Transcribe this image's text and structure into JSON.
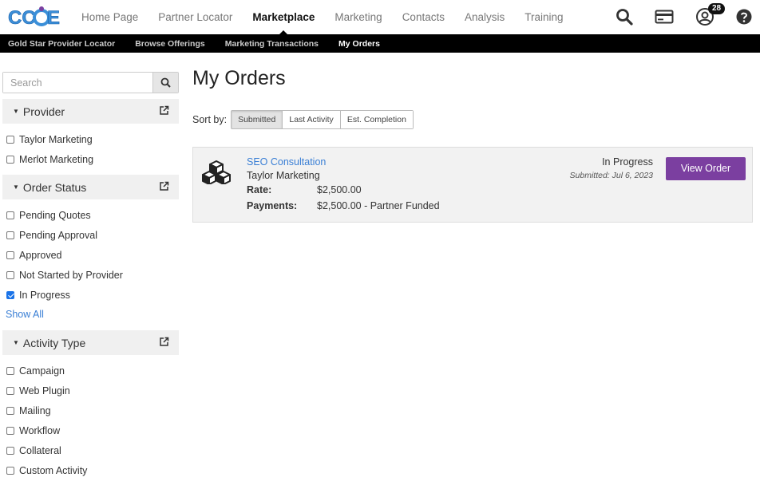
{
  "brand": {
    "logo_text": "CCOE",
    "accent_color": "#7b3fa0",
    "link_color": "#3a7fd5"
  },
  "topnav": {
    "items": [
      {
        "label": "Home Page",
        "active": false
      },
      {
        "label": "Partner Locator",
        "active": false
      },
      {
        "label": "Marketplace",
        "active": true
      },
      {
        "label": "Marketing",
        "active": false
      },
      {
        "label": "Contacts",
        "active": false
      },
      {
        "label": "Analysis",
        "active": false
      },
      {
        "label": "Training",
        "active": false
      }
    ],
    "icons": [
      "search-icon",
      "card-icon",
      "user-icon",
      "help-icon"
    ],
    "notification_count": "28"
  },
  "subnav": {
    "items": [
      {
        "label": "Gold Star Provider Locator",
        "active": false
      },
      {
        "label": "Browse Offerings",
        "active": false
      },
      {
        "label": "Marketing Transactions",
        "active": false
      },
      {
        "label": "My Orders",
        "active": true
      }
    ]
  },
  "sidebar": {
    "search_placeholder": "Search",
    "groups": [
      {
        "title": "Provider",
        "options": [
          {
            "label": "Taylor Marketing",
            "checked": false
          },
          {
            "label": "Merlot Marketing",
            "checked": false
          }
        ],
        "show_all": null
      },
      {
        "title": "Order Status",
        "options": [
          {
            "label": "Pending Quotes",
            "checked": false
          },
          {
            "label": "Pending Approval",
            "checked": false
          },
          {
            "label": "Approved",
            "checked": false
          },
          {
            "label": "Not Started by Provider",
            "checked": false
          },
          {
            "label": "In Progress",
            "checked": true
          }
        ],
        "show_all": "Show All"
      },
      {
        "title": "Activity Type",
        "options": [
          {
            "label": "Campaign",
            "checked": false
          },
          {
            "label": "Web Plugin",
            "checked": false
          },
          {
            "label": "Mailing",
            "checked": false
          },
          {
            "label": "Workflow",
            "checked": false
          },
          {
            "label": "Collateral",
            "checked": false
          },
          {
            "label": "Custom Activity",
            "checked": false
          }
        ],
        "show_all": null
      }
    ]
  },
  "main": {
    "title": "My Orders",
    "sort_label": "Sort by:",
    "sort_options": [
      {
        "label": "Submitted",
        "active": true
      },
      {
        "label": "Last Activity",
        "active": false
      },
      {
        "label": "Est. Completion",
        "active": false
      }
    ],
    "orders": [
      {
        "title": "SEO Consultation",
        "vendor": "Taylor Marketing",
        "rate_label": "Rate:",
        "rate": "$2,500.00",
        "payments_label": "Payments:",
        "payments": "$2,500.00 - Partner Funded",
        "status": "In Progress",
        "submitted": "Submitted: Jul 6, 2023",
        "button_label": "View Order",
        "icon": "cubes-icon"
      }
    ]
  }
}
